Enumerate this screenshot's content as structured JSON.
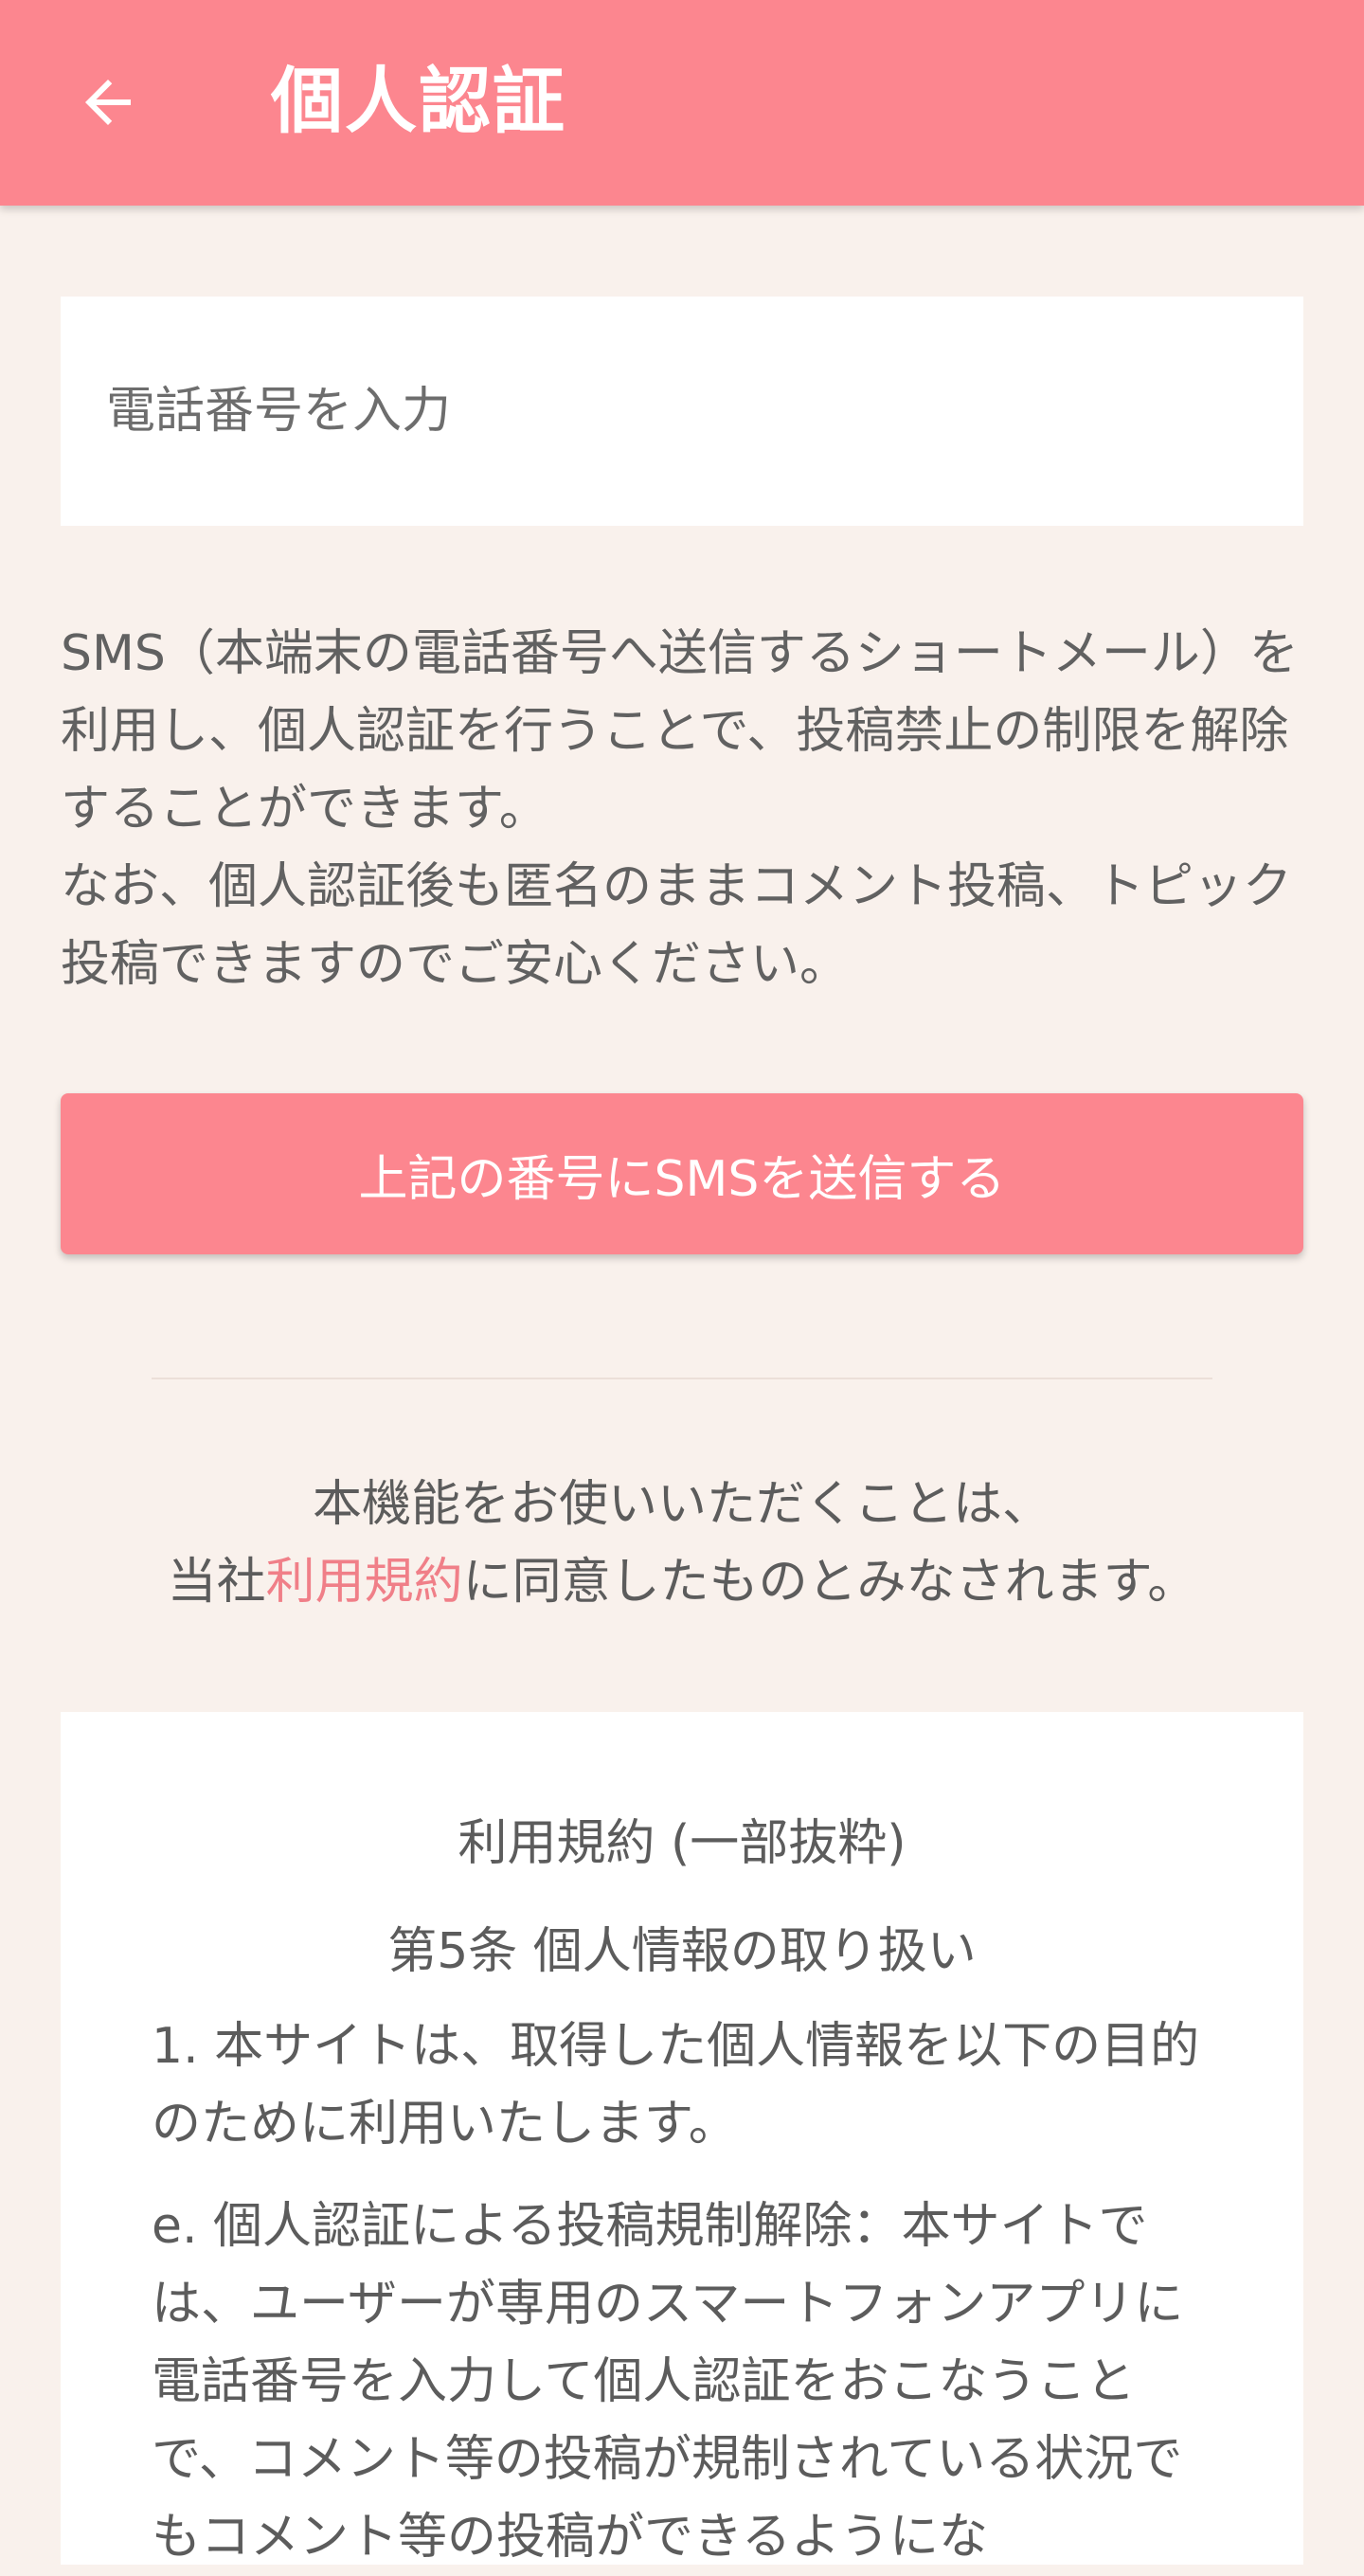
{
  "header": {
    "title": "個人認証"
  },
  "phone_input": {
    "placeholder": "電話番号を入力",
    "value": ""
  },
  "description": "SMS（本端末の電話番号へ送信するショートメール）を利用し、個人認証を行うことで、投稿禁止の制限を解除することができます。\nなお、個人認証後も匿名のままコメント投稿、トピック投稿できますのでご安心ください。",
  "send_button": {
    "label": "上記の番号にSMSを送信する"
  },
  "agreement": {
    "line1": "本機能をお使いいただくことは、",
    "prefix": "当社",
    "link": "利用規約",
    "suffix": "に同意したものとみなされます。"
  },
  "terms": {
    "title": "利用規約 (一部抜粋)",
    "article": "第5条 個人情報の取り扱い",
    "para1": "1. 本サイトは、取得した個人情報を以下の目的のために利用いたします。",
    "para2": "e. 個人認証による投稿規制解除：本サイトでは、ユーザーが専用のスマートフォンアプリに電話番号を入力して個人認証をおこなうことで、コメント等の投稿が規制されている状況でもコメント等の投稿ができるようにな"
  },
  "colors": {
    "accent": "#fc868f",
    "link": "#f07f88",
    "background": "#f9f1ec"
  },
  "icons": {
    "back": "arrow-left-icon"
  }
}
